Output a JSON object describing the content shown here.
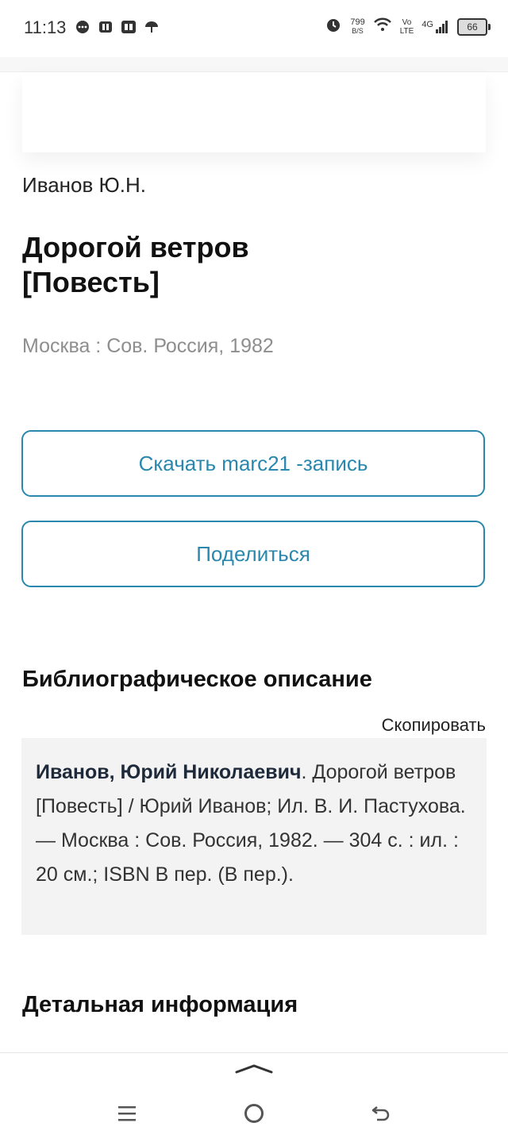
{
  "status_bar": {
    "time": "11:13",
    "net_speed_value": "799",
    "net_speed_unit": "B/S",
    "volte_top": "Vo",
    "volte_bottom": "LTE",
    "network": "4G",
    "battery": "66"
  },
  "book": {
    "author": "Иванов Ю.Н.",
    "title_line1": "Дорогой ветров",
    "title_line2": "[Повесть]",
    "publisher": "Москва : Сов. Россия, 1982"
  },
  "actions": {
    "download_marc": "Скачать marc21 -запись",
    "share": "Поделиться"
  },
  "bibliography": {
    "heading": "Библиографическое описание",
    "copy_label": "Скопировать",
    "author_bold": "Иванов, Юрий Николаевич",
    "description": ". Дорогой ветров [Повесть] / Юрий Иванов; Ил. В. И. Пастухова. — Москва : Сов. Россия, 1982. — 304 с. : ил. : 20 см.; ISBN В пер. (В пер.)."
  },
  "details": {
    "heading": "Детальная информация"
  },
  "colors": {
    "accent": "#2a87ad",
    "muted_text": "#8e8e8e",
    "bib_background": "#f3f3f3"
  }
}
